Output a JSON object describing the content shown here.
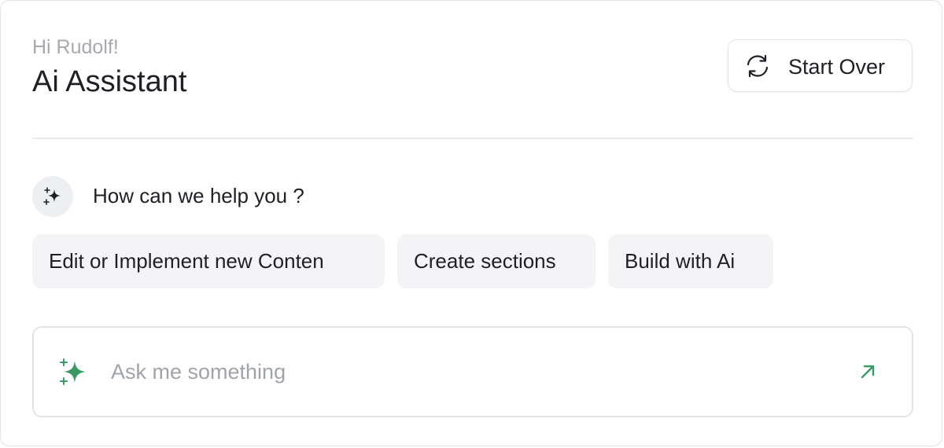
{
  "header": {
    "greeting": "Hi Rudolf!",
    "title": "Ai Assistant",
    "start_over_label": "Start Over",
    "start_over_icon": "refresh-icon"
  },
  "help": {
    "icon": "sparkles-icon",
    "prompt": "How can we help you ?"
  },
  "suggestions": [
    {
      "label": "Edit or Implement new Conten"
    },
    {
      "label": "Create sections"
    },
    {
      "label": "Build with Ai"
    }
  ],
  "ask": {
    "placeholder": "Ask me something",
    "value": "",
    "leading_icon": "sparkles-icon",
    "send_icon": "arrow-up-right-icon"
  },
  "colors": {
    "accent": "#3a9a64",
    "text": "#1f2026",
    "muted": "#a7a9b1",
    "chip_bg": "#f4f4f6",
    "border": "#e3e4e8"
  }
}
